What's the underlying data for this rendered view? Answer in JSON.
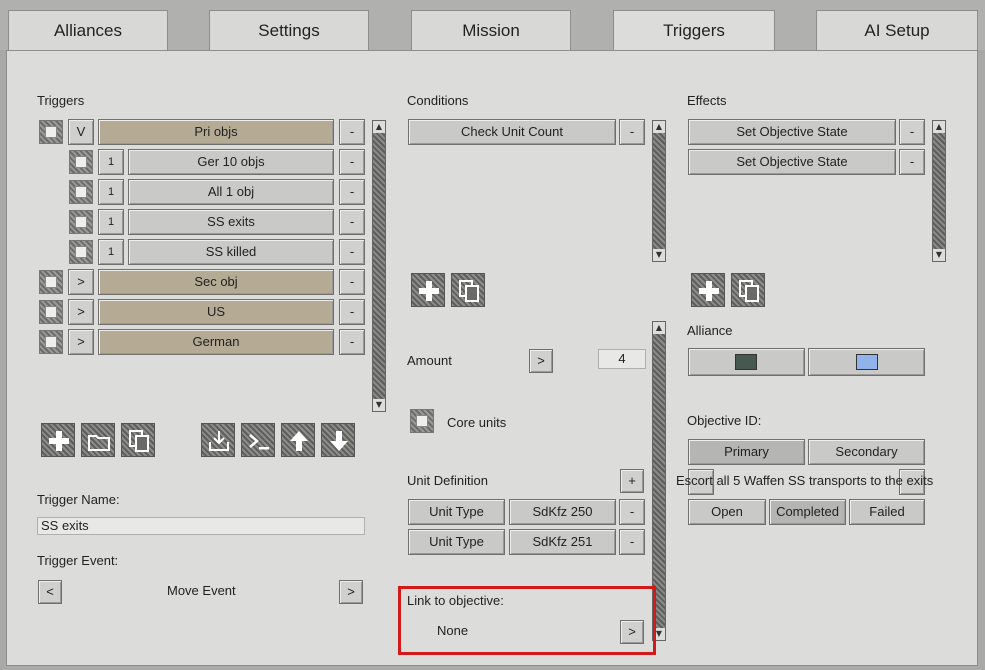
{
  "tabs": [
    "Alliances",
    "Settings",
    "Mission",
    "Triggers",
    "AI Setup"
  ],
  "triggers": {
    "header": "Triggers",
    "items": [
      {
        "toggle": "V",
        "label": "Pri objs",
        "tan": true
      },
      {
        "toggle": "1",
        "label": "Ger 10 objs",
        "tan": false
      },
      {
        "toggle": "1",
        "label": "All 1 obj",
        "tan": false
      },
      {
        "toggle": "1",
        "label": "SS exits",
        "tan": false
      },
      {
        "toggle": "1",
        "label": "SS killed",
        "tan": false
      },
      {
        "toggle": ">",
        "label": "Sec obj",
        "tan": true
      },
      {
        "toggle": ">",
        "label": "US",
        "tan": true
      },
      {
        "toggle": ">",
        "label": "German",
        "tan": true
      }
    ],
    "remove_label": "-",
    "name_label": "Trigger Name:",
    "name_value": "SS exits",
    "event_label": "Trigger Event:",
    "event_value": "Move Event",
    "prev": "<",
    "next": ">"
  },
  "conditions": {
    "header": "Conditions",
    "items": [
      "Check Unit Count"
    ],
    "amount_label": "Amount",
    "amount_arrow": ">",
    "amount_value": "4",
    "core_units_label": "Core units",
    "unit_def_label": "Unit Definition",
    "add": "+",
    "units": [
      {
        "type": "Unit Type",
        "value": "SdKfz 250"
      },
      {
        "type": "Unit Type",
        "value": "SdKfz 251"
      }
    ],
    "link_label": "Link to objective:",
    "link_value": "None",
    "link_arrow": ">"
  },
  "effects": {
    "header": "Effects",
    "items": [
      "Set Objective State",
      "Set Objective State"
    ],
    "alliance_label": "Alliance",
    "alliance_colors": [
      "#46584f",
      "#8fb3ea"
    ],
    "objective_id_label": "Objective ID:",
    "objective_types": [
      "Primary",
      "Secondary"
    ],
    "objective_text": "Escort all 5 Waffen SS transports to the exits",
    "states": [
      "Open",
      "Completed",
      "Failed"
    ]
  }
}
